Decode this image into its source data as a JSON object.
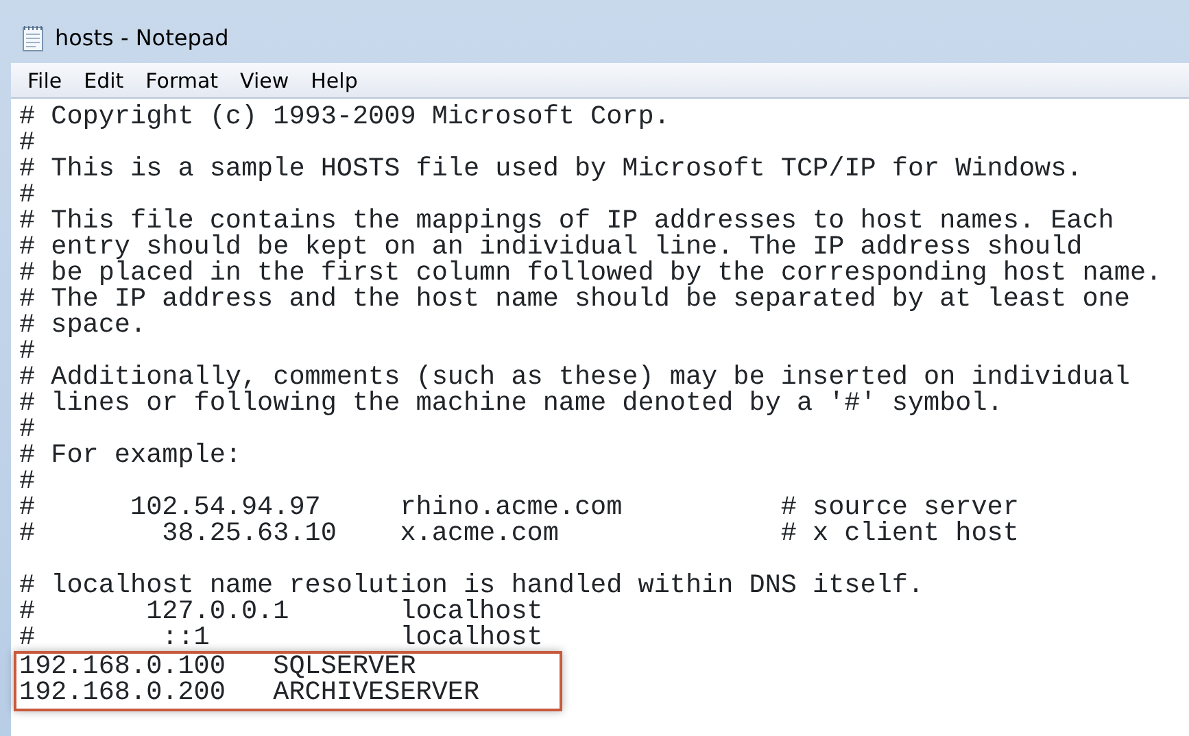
{
  "window": {
    "title": "hosts - Notepad"
  },
  "menu": [
    "File",
    "Edit",
    "Format",
    "View",
    "Help"
  ],
  "lines": [
    {
      "kind": "text",
      "text": "# Copyright (c) 1993-2009 Microsoft Corp."
    },
    {
      "kind": "text",
      "text": "#"
    },
    {
      "kind": "text",
      "text": "# This is a sample HOSTS file used by Microsoft TCP/IP for Windows."
    },
    {
      "kind": "text",
      "text": "#"
    },
    {
      "kind": "text",
      "text": "# This file contains the mappings of IP addresses to host names. Each"
    },
    {
      "kind": "text",
      "text": "# entry should be kept on an individual line. The IP address should"
    },
    {
      "kind": "text",
      "text": "# be placed in the first column followed by the corresponding host name."
    },
    {
      "kind": "text",
      "text": "# The IP address and the host name should be separated by at least one"
    },
    {
      "kind": "text",
      "text": "# space."
    },
    {
      "kind": "text",
      "text": "#"
    },
    {
      "kind": "text",
      "text": "# Additionally, comments (such as these) may be inserted on individual"
    },
    {
      "kind": "text",
      "text": "# lines or following the machine name denoted by a '#' symbol."
    },
    {
      "kind": "text",
      "text": "#"
    },
    {
      "kind": "text",
      "text": "# For example:"
    },
    {
      "kind": "text",
      "text": "#"
    },
    {
      "kind": "text",
      "text": "#      102.54.94.97     rhino.acme.com          # source server"
    },
    {
      "kind": "text",
      "text": "#        38.25.63.10    x.acme.com              # x client host"
    },
    {
      "kind": "blank"
    },
    {
      "kind": "text",
      "text": "# localhost name resolution is handled within DNS itself."
    },
    {
      "kind": "text",
      "text": "#       127.0.0.1       localhost"
    },
    {
      "kind": "text",
      "text": "#        ::1            localhost"
    }
  ],
  "highlighted_lines": [
    "192.168.0.100   SQLSERVER",
    "192.168.0.200   ARCHIVESERVER"
  ]
}
